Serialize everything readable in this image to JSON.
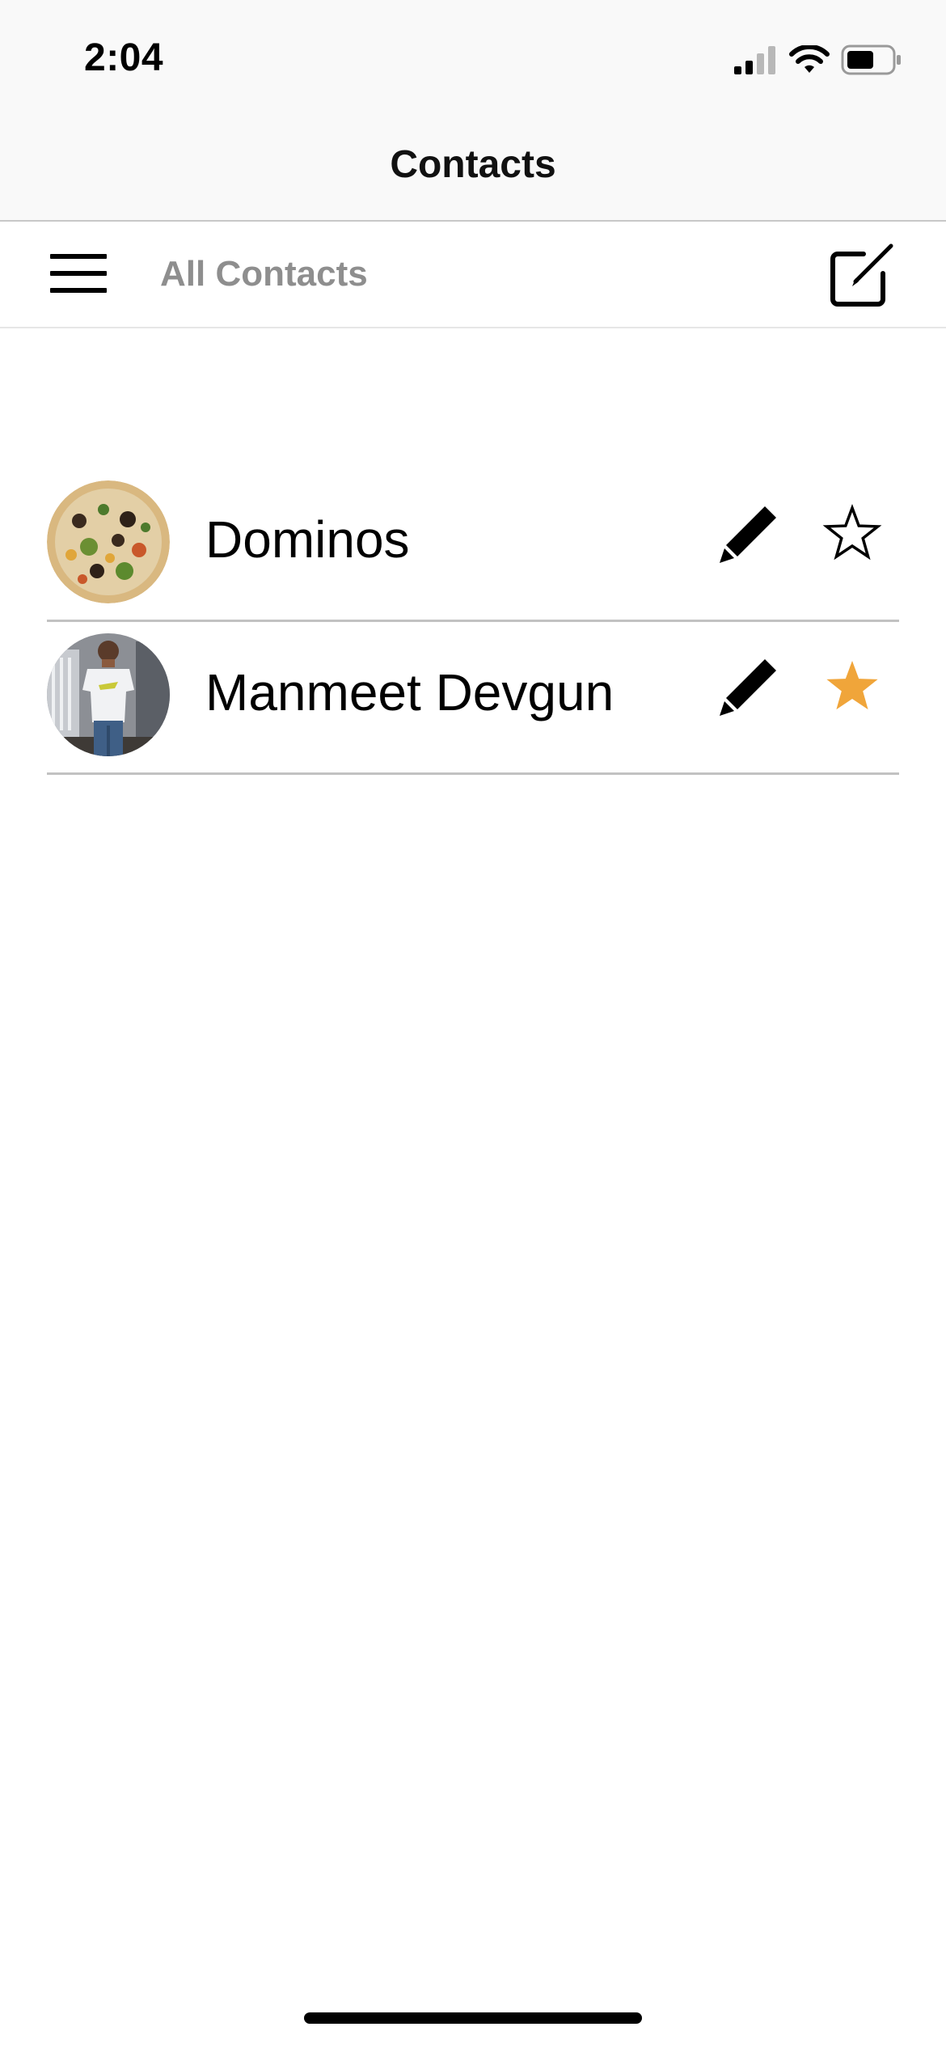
{
  "status_bar": {
    "time": "2:04",
    "icons": [
      "cellular-signal-icon",
      "wifi-icon",
      "battery-icon"
    ]
  },
  "nav": {
    "title": "Contacts"
  },
  "toolbar": {
    "title": "All Contacts",
    "menu_icon": "hamburger-menu-icon",
    "compose_icon": "compose-icon"
  },
  "contacts": [
    {
      "name": "Dominos",
      "avatar": "pizza-photo",
      "favorite": false
    },
    {
      "name": "Manmeet Devgun",
      "avatar": "person-photo",
      "favorite": true
    }
  ],
  "colors": {
    "favorite_star": "#f0a53a",
    "toolbar_title": "#8e8e8e",
    "bar_background": "#f9f9f9",
    "divider": "#c2c2c2"
  }
}
